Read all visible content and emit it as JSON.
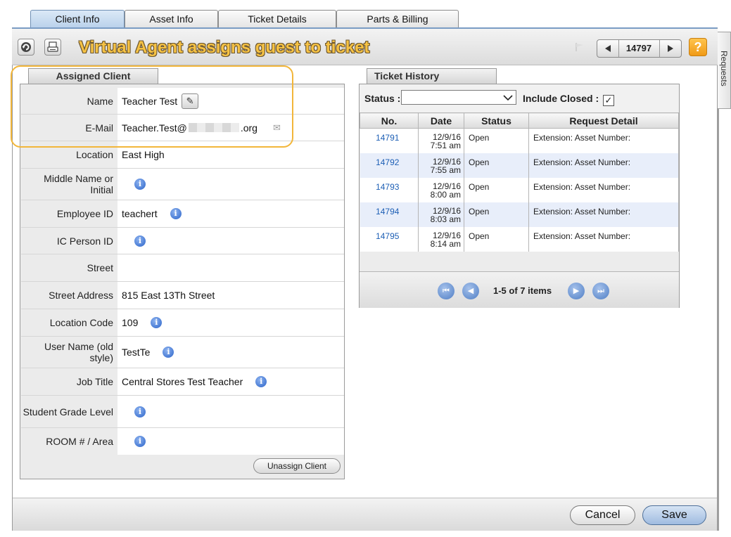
{
  "tabs": [
    {
      "label": "Client Info",
      "active": true
    },
    {
      "label": "Asset Info",
      "active": false
    },
    {
      "label": "Ticket Details",
      "active": false
    },
    {
      "label": "Parts & Billing",
      "active": false
    }
  ],
  "toolbar": {
    "annotation": "Virtual Agent assigns guest to ticket",
    "ticket_number": "14797",
    "help_label": "?"
  },
  "client": {
    "section_title": "Assigned Client",
    "fields": [
      {
        "label": "Name",
        "value": "Teacher Test"
      },
      {
        "label": "E-Mail",
        "value_prefix": "Teacher.Test@",
        "value_suffix": ".org"
      },
      {
        "label": "Location",
        "value": "East High"
      },
      {
        "label": "Middle Name or Initial",
        "value": ""
      },
      {
        "label": "Employee ID",
        "value": "teachert"
      },
      {
        "label": "IC Person ID",
        "value": ""
      },
      {
        "label": "Street",
        "value": ""
      },
      {
        "label": "Street Address",
        "value": "815 East 13Th Street"
      },
      {
        "label": "Location Code",
        "value": "109"
      },
      {
        "label": "User Name (old style)",
        "value": "TestTe"
      },
      {
        "label": "Job Title",
        "value": "Central Stores Test Teacher"
      },
      {
        "label": "Student Grade Level",
        "value": ""
      },
      {
        "label": "ROOM # / Area",
        "value": ""
      }
    ],
    "unassign_label": "Unassign Client"
  },
  "history": {
    "section_title": "Ticket History",
    "status_label": "Status :",
    "status_value": "",
    "include_closed_label": "Include Closed :",
    "include_closed_checked": true,
    "columns": [
      "No.",
      "Date",
      "Status",
      "Request Detail"
    ],
    "rows": [
      {
        "no": "14791",
        "date": "12/9/16",
        "time": "7:51 am",
        "status": "Open",
        "detail": "Extension: Asset Number:"
      },
      {
        "no": "14792",
        "date": "12/9/16",
        "time": "7:55 am",
        "status": "Open",
        "detail": "Extension: Asset Number:"
      },
      {
        "no": "14793",
        "date": "12/9/16",
        "time": "8:00 am",
        "status": "Open",
        "detail": "Extension: Asset Number:"
      },
      {
        "no": "14794",
        "date": "12/9/16",
        "time": "8:03 am",
        "status": "Open",
        "detail": "Extension: Asset Number:"
      },
      {
        "no": "14795",
        "date": "12/9/16",
        "time": "8:14 am",
        "status": "Open",
        "detail": "Extension: Asset Number:"
      }
    ],
    "pager_text": "1-5 of 7 items"
  },
  "footer": {
    "cancel_label": "Cancel",
    "save_label": "Save"
  },
  "side_rail": {
    "label": "Requests"
  },
  "colors": {
    "accent": "#7a9cc4",
    "link": "#1d5fb5",
    "annotation": "#f6c244",
    "highlight": "#f2b63a"
  }
}
